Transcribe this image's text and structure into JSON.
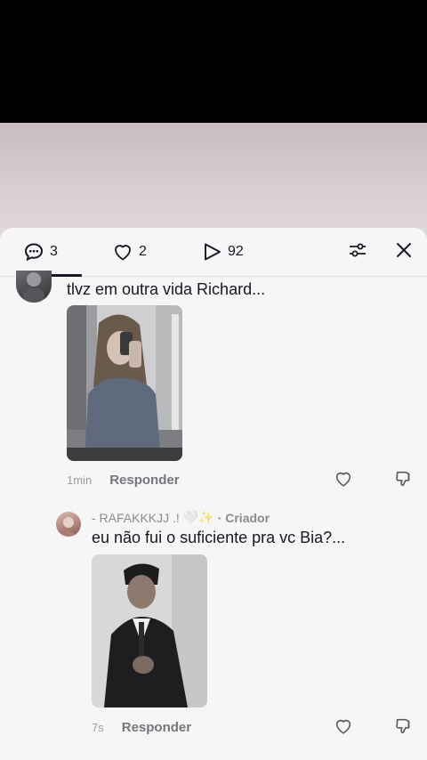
{
  "tabs": {
    "comments": {
      "icon": "comment-icon",
      "count": "3"
    },
    "likes": {
      "icon": "heart-icon",
      "count": "2"
    },
    "views": {
      "icon": "play-icon",
      "count": "92"
    },
    "filter_icon": "sliders-icon",
    "close_icon": "close-icon"
  },
  "comments": [
    {
      "avatar": "user-avatar",
      "text": "tlvz em outra vida Richard...",
      "image": "mirror-selfie-photo",
      "time": "1min",
      "reply_label": "Responder"
    },
    {
      "author": "- RAFAKKKJJ .! ",
      "author_decoration": "🤍✨",
      "creator_label": "· Criador",
      "text": "eu não fui o suficiente pra vc Bia?...",
      "image": "suit-portrait-photo",
      "time": "7s",
      "reply_label": "Responder"
    }
  ],
  "colors": {
    "sheet": "#f6f6f7",
    "text": "#161823",
    "muted": "#8a8b91"
  }
}
